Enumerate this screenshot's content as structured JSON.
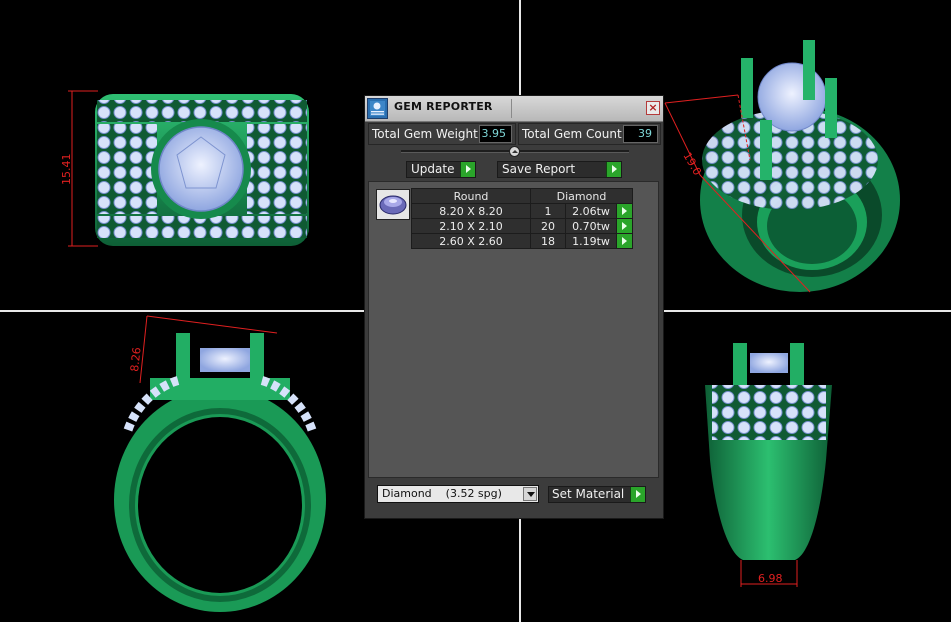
{
  "panel": {
    "title": "GEM REPORTER",
    "close_label": "×",
    "total_weight_label": "Total Gem Weight",
    "total_weight_value": "3.95",
    "total_count_label": "Total Gem Count",
    "total_count_value": "39",
    "update_label": "Update",
    "save_report_label": "Save Report",
    "table": {
      "headers": [
        "Round",
        "Diamond"
      ],
      "rows": [
        {
          "size": "8.20 X 8.20",
          "count": "1",
          "weight": "2.06tw"
        },
        {
          "size": "2.10 X 2.10",
          "count": "20",
          "weight": "0.70tw"
        },
        {
          "size": "2.60 X 2.60",
          "count": "18",
          "weight": "1.19tw"
        }
      ]
    },
    "material_select": "Diamond    (3.52 spg)",
    "set_material_label": "Set Material"
  },
  "viewports": {
    "front_dimension": "15.41",
    "side_dimension": "8.26",
    "perspective_dimension": "19.0",
    "bottom_dimension": "6.98"
  },
  "colors": {
    "metal": "#1f9a5a",
    "metal_dark": "#0c5a32",
    "gem": "#c8d8f6",
    "dimension": "#e02020",
    "go_button": "#2aa52a"
  }
}
